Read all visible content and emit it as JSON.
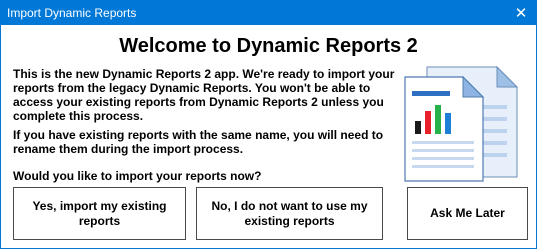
{
  "window": {
    "title": "Import Dynamic Reports",
    "close_glyph": "✕"
  },
  "heading": "Welcome to Dynamic Reports 2",
  "paragraphs": [
    "This is the new Dynamic Reports 2 app. We're ready to import your reports from the legacy Dynamic Reports. You won't be able to access your existing reports from Dynamic Reports 2 unless you complete this process.",
    "If you have existing reports with the same name, you will need to rename them during the import process."
  ],
  "question": "Would you like to import your reports now?",
  "buttons": {
    "yes": "Yes, import my existing reports",
    "no": "No, I do not want to use my existing reports",
    "later": "Ask Me Later"
  },
  "icon": {
    "name": "report-document-icon",
    "bar_colors": [
      "#1a1a1a",
      "#e8202a",
      "#25b24a",
      "#1e7fd6"
    ]
  }
}
